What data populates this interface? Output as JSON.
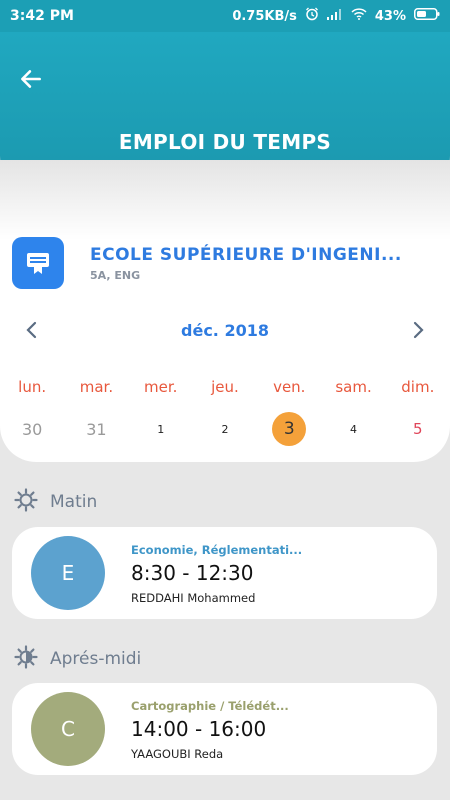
{
  "status_bar": {
    "time": "3:42 PM",
    "speed": "0.75KB/s",
    "battery": "43%"
  },
  "header": {
    "title": "EMPLOI DU TEMPS"
  },
  "school": {
    "name": "ECOLE SUPÉRIEURE D'INGENI...",
    "subtitle": "5A, ENG"
  },
  "calendar": {
    "month": "déc. 2018",
    "days": [
      {
        "name": "lun.",
        "num": "30"
      },
      {
        "name": "mar.",
        "num": "31"
      },
      {
        "name": "mer.",
        "num": "1"
      },
      {
        "name": "jeu.",
        "num": "2"
      },
      {
        "name": "ven.",
        "num": "3"
      },
      {
        "name": "sam.",
        "num": "4"
      },
      {
        "name": "dim.",
        "num": "5"
      }
    ]
  },
  "sections": {
    "morning": {
      "title": "Matin",
      "card": {
        "initial": "E",
        "subject": "Economie, Réglementati...",
        "time": "8:30 - 12:30",
        "teacher": "REDDAHI Mohammed",
        "avatar_color": "#5ca2cf",
        "subject_color": "#3f96c8"
      }
    },
    "afternoon": {
      "title": "Aprés-midi",
      "card": {
        "initial": "C",
        "subject": "Cartographie / Télédét...",
        "time": "14:00 - 16:00",
        "teacher": "YAAGOUBI Reda",
        "avatar_color": "#a3ab7c",
        "subject_color": "#9aa06d"
      }
    }
  },
  "colors": {
    "header": "#1fa4bc",
    "accent_blue": "#2e7be0",
    "weekday": "#e8583d",
    "selected_day": "#f4a13a",
    "sunday": "#e0465a"
  }
}
